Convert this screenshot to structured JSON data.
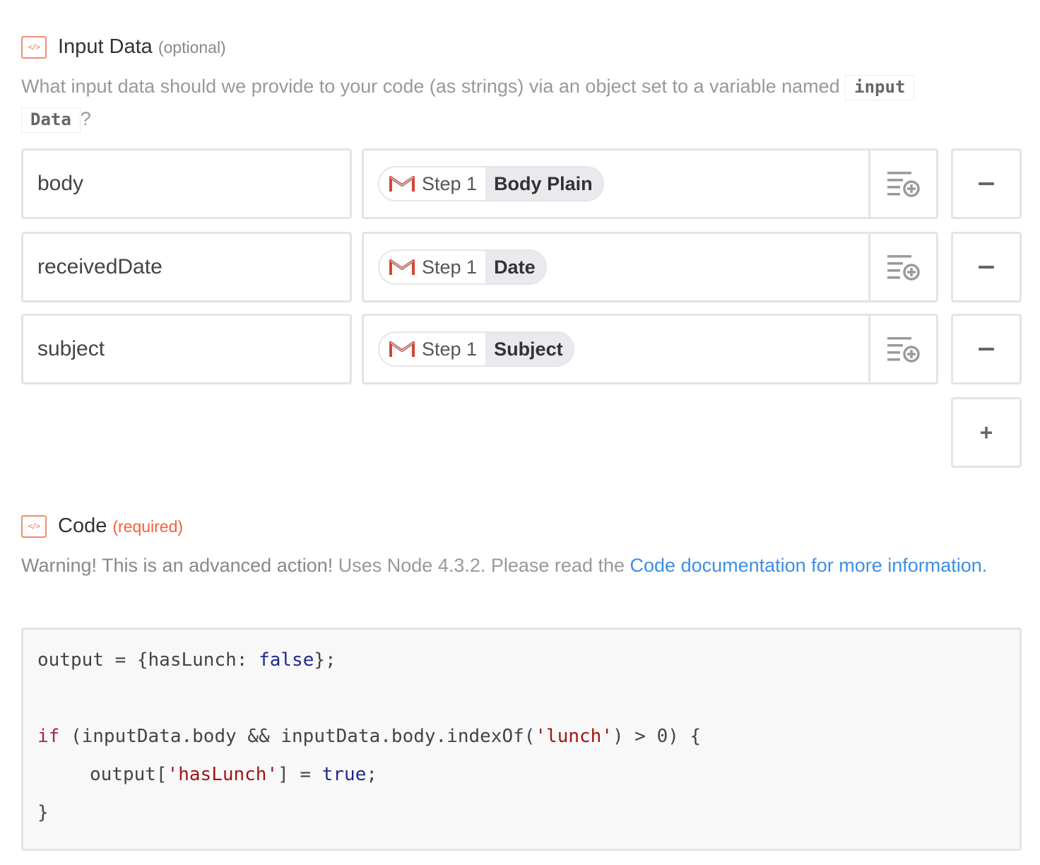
{
  "input_section": {
    "title": "Input Data",
    "tag": "(optional)",
    "help_text": "What input data should we provide to your code (as strings) via an object set to a variable named ",
    "help_code": "inputData",
    "help_suffix": "?",
    "icon": "code-icon",
    "rows": [
      {
        "key": "body",
        "step": "Step 1",
        "field": "Body Plain"
      },
      {
        "key": "receivedDate",
        "step": "Step 1",
        "field": "Date"
      },
      {
        "key": "subject",
        "step": "Step 1",
        "field": "Subject"
      }
    ],
    "add_label": "+"
  },
  "code_section": {
    "title": "Code",
    "tag": "(required)",
    "warning_bold": "Warning! This is an advanced action!",
    "warning_rest": " Uses Node 4.3.2. Please read the ",
    "link_text": "Code documentation for more information.",
    "icon": "code-icon"
  },
  "code": {
    "line1": {
      "a": "output = {hasLunch: ",
      "b": "false",
      "c": "};"
    },
    "line2": {
      "kw": "if",
      "a": " (inputData.body && inputData.body.indexOf(",
      "str": "'lunch'",
      "b": ") > 0) {"
    },
    "line3": {
      "a": "output[",
      "str": "'hasLunch'",
      "b": "] = ",
      "lit": "true",
      "c": ";"
    },
    "line4": "}"
  },
  "colors": {
    "accent_required": "#f0623d",
    "link": "#3d8fe3",
    "gmail_red": "#d44638"
  }
}
